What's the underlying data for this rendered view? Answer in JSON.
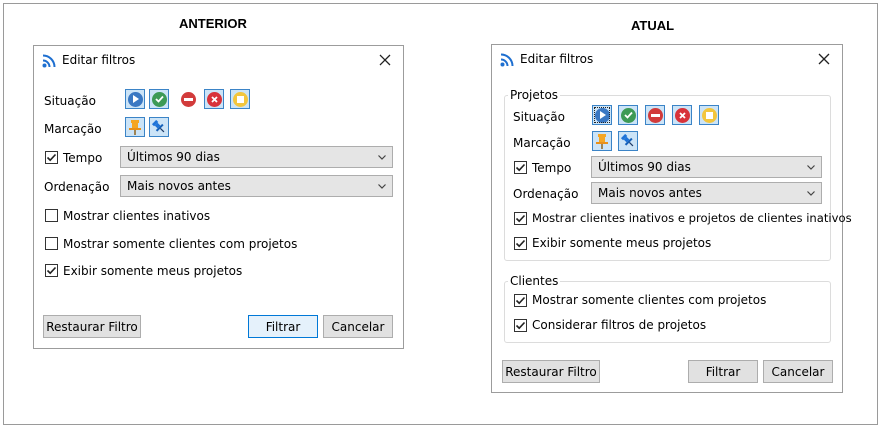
{
  "headings": {
    "before": "ANTERIOR",
    "after": "ATUAL"
  },
  "old_dialog": {
    "title": "Editar filtros",
    "situacao_label": "Situação",
    "marcacao_label": "Marcação",
    "tempo_label": "Tempo",
    "tempo_checked": true,
    "tempo_value": "Últimos 90 dias",
    "ordenacao_label": "Ordenação",
    "ordenacao_value": "Mais novos antes",
    "checkboxes": [
      {
        "label": "Mostrar clientes inativos",
        "checked": false
      },
      {
        "label": "Mostrar somente clientes com projetos",
        "checked": false
      },
      {
        "label": "Exibir somente meus projetos",
        "checked": true
      }
    ],
    "buttons": {
      "reset": "Restaurar Filtro",
      "apply": "Filtrar",
      "cancel": "Cancelar"
    }
  },
  "new_dialog": {
    "title": "Editar filtros",
    "projetos_group": "Projetos",
    "situacao_label": "Situação",
    "marcacao_label": "Marcação",
    "tempo_label": "Tempo",
    "tempo_checked": true,
    "tempo_value": "Últimos 90 dias",
    "ordenacao_label": "Ordenação",
    "ordenacao_value": "Mais novos antes",
    "projetos_checkboxes": [
      {
        "label": "Mostrar clientes inativos e projetos de clientes inativos",
        "checked": true
      },
      {
        "label": "Exibir somente meus projetos",
        "checked": true
      }
    ],
    "clientes_group": "Clientes",
    "clientes_checkboxes": [
      {
        "label": "Mostrar somente clientes com projetos",
        "checked": true
      },
      {
        "label": "Considerar filtros de projetos",
        "checked": true
      }
    ],
    "buttons": {
      "reset": "Restaurar Filtro",
      "apply": "Filtrar",
      "cancel": "Cancelar"
    }
  },
  "icons": {
    "situacao": [
      "play-circle-icon",
      "check-circle-icon",
      "minus-circle-icon",
      "x-circle-icon",
      "pause-circle-icon"
    ],
    "marcacao": [
      "pin-orange-icon",
      "pin-blue-icon"
    ]
  },
  "colors": {
    "play": "#3a78c3",
    "check": "#3d9a55",
    "minus": "#d23b3b",
    "x": "#d8323a",
    "pause": "#f3c63d",
    "selected_bg": "#cce4f7",
    "selected_border": "#3b84c7",
    "primary_border": "#0078d7",
    "rss": "#1e6fd0"
  }
}
